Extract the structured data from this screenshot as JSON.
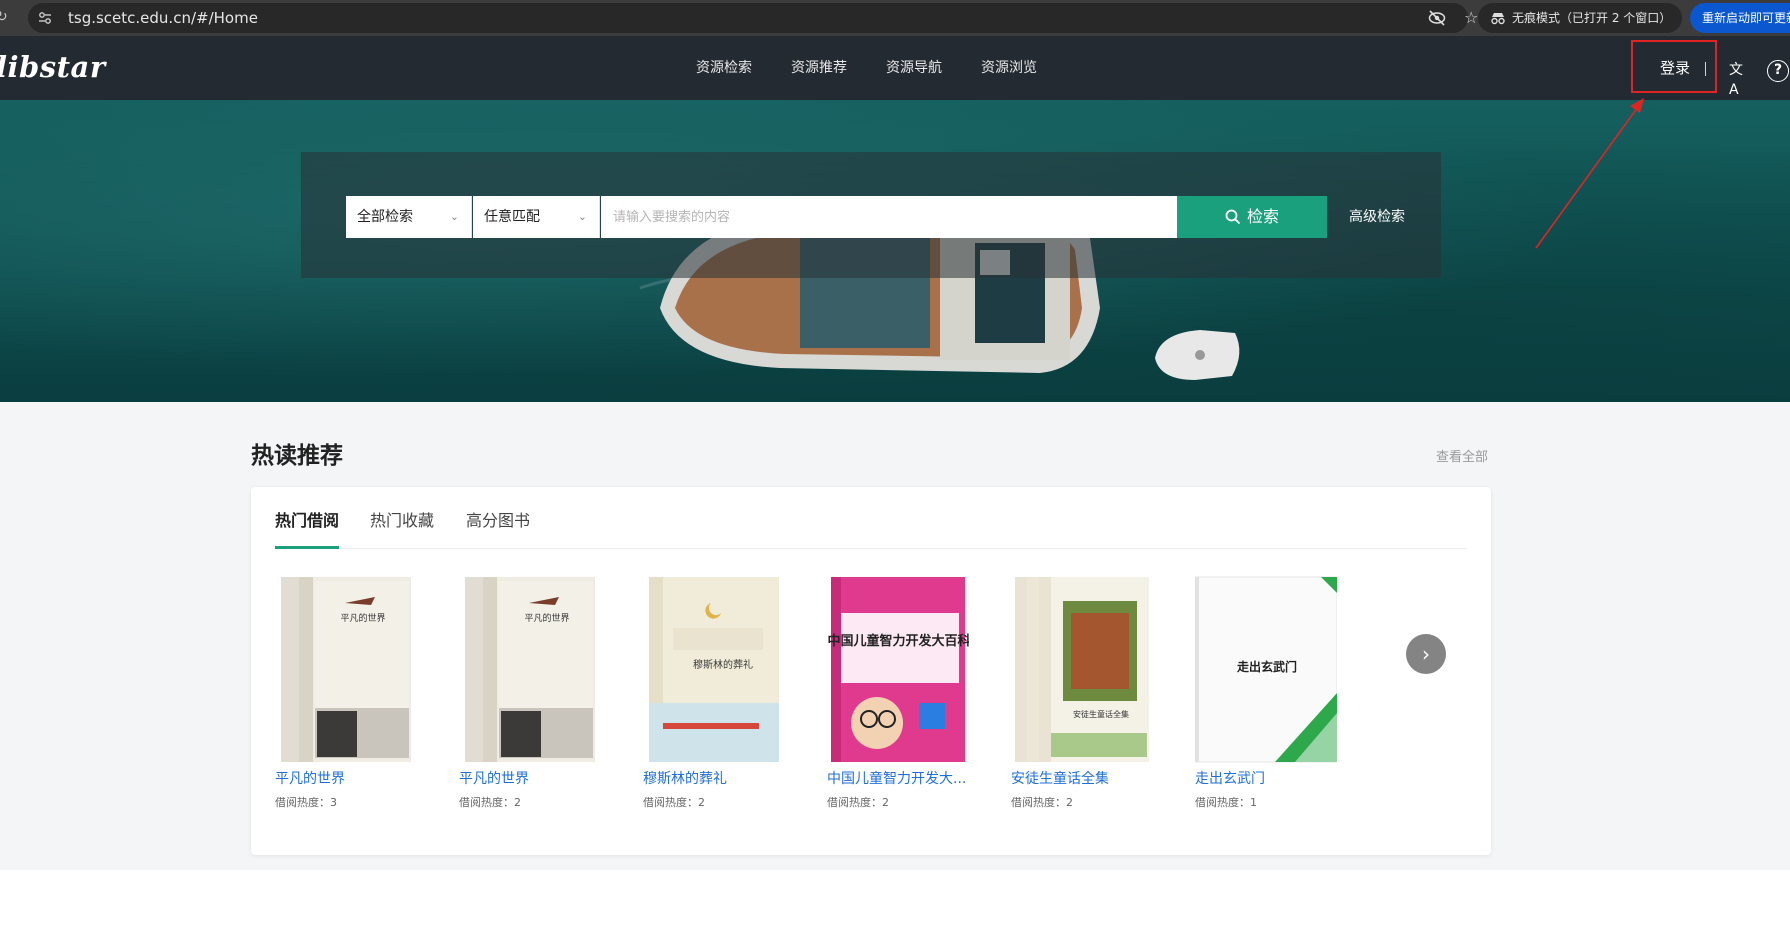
{
  "browser": {
    "url": "tsg.scetc.edu.cn/#/Home",
    "incognito_label": "无痕模式（已打开 2 个窗口）",
    "restart_label": "重新启动即可更新"
  },
  "header": {
    "logo": "libstar",
    "nav": [
      "资源检索",
      "资源推荐",
      "资源导航",
      "资源浏览"
    ],
    "login": "登录",
    "translate_icon": "文A",
    "help_icon": "?"
  },
  "search": {
    "scope": "全部检索",
    "match": "任意匹配",
    "placeholder": "请输入要搜索的内容",
    "button": "检索",
    "advanced": "高级检索"
  },
  "recommend": {
    "title": "热读推荐",
    "view_all": "查看全部",
    "tabs": [
      "热门借阅",
      "热门收藏",
      "高分图书"
    ],
    "active_tab": 0,
    "books": [
      {
        "title": "平凡的世界",
        "heat": "借阅热度：3",
        "cover_text": "平凡的世界"
      },
      {
        "title": "平凡的世界",
        "heat": "借阅热度：2",
        "cover_text": "平凡的世界"
      },
      {
        "title": "穆斯林的葬礼",
        "heat": "借阅热度：2",
        "cover_text": "穆斯林的葬礼"
      },
      {
        "title": "中国儿童智力开发大...",
        "heat": "借阅热度：2",
        "cover_text": "中国儿童智力开发大百科"
      },
      {
        "title": "安徒生童话全集",
        "heat": "借阅热度：2",
        "cover_text": "安徒生童话全集"
      },
      {
        "title": "走出玄武门",
        "heat": "借阅热度：1",
        "cover_text": "走出玄武门"
      }
    ]
  },
  "colors": {
    "accent": "#1aa07c",
    "header_bg": "#232a32",
    "link": "#1f6fd8",
    "annotation": "#e02424"
  }
}
